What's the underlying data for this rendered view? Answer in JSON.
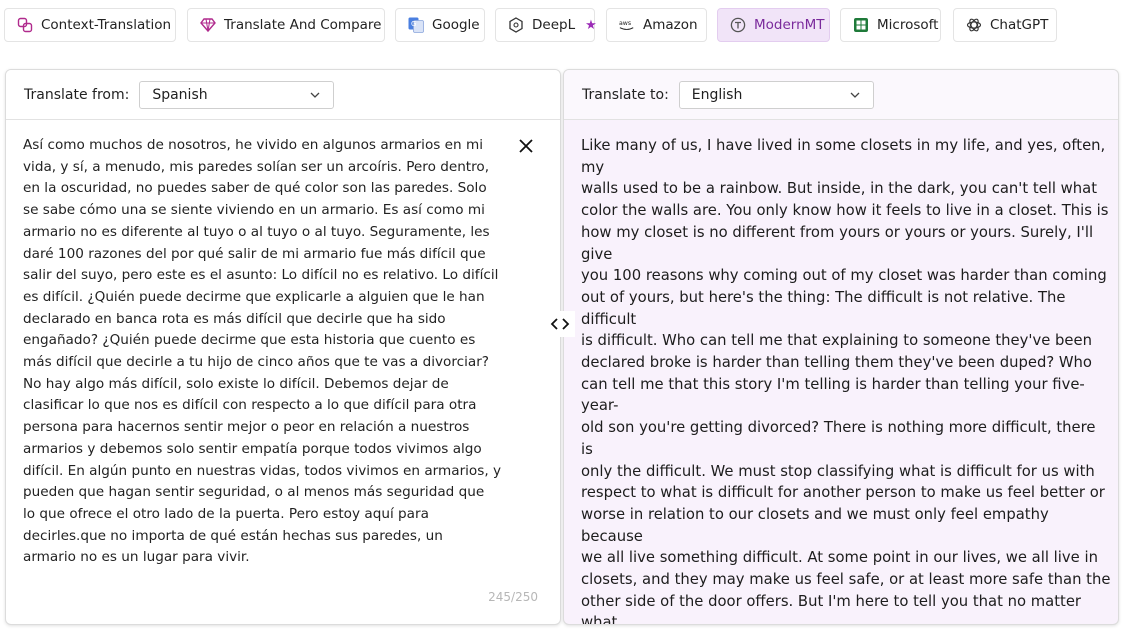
{
  "tabs": [
    {
      "label": "Context-Translation",
      "icon": "context-translation-icon"
    },
    {
      "label": "Translate And Compare",
      "icon": "diamond-icon"
    },
    {
      "label": "Google",
      "icon": "google-translate-icon"
    },
    {
      "label": "DeepL",
      "icon": "deepl-icon",
      "badge": "star-icon"
    },
    {
      "label": "Amazon",
      "icon": "aws-icon"
    },
    {
      "label": "ModernMT",
      "icon": "modernmt-icon",
      "active": true
    },
    {
      "label": "Microsoft",
      "icon": "microsoft-icon"
    },
    {
      "label": "ChatGPT",
      "icon": "chatgpt-icon"
    }
  ],
  "source": {
    "label": "Translate from:",
    "language": "Spanish",
    "text": "Así como muchos de nosotros, he vivido en algunos armarios en mi\nvida, y sí, a menudo, mis paredes solían ser un arcoíris. Pero dentro,\nen la oscuridad, no puedes saber de qué color son las paredes. Solo\nse sabe cómo una se siente viviendo en un armario. Es así como mi\narmario no es diferente al tuyo o al tuyo o al tuyo. Seguramente, les\ndaré 100 razones del por qué salir de mi armario fue más difícil que\nsalir del suyo, pero este es el asunto: Lo difícil no es relativo. Lo difícil\nes difícil. ¿Quién puede decirme que explicarle a alguien que le han\ndeclarado en banca rota es más difícil que decirle que ha sido\nengañado? ¿Quién puede decirme que esta historia que cuento es\nmás difícil que decirle a tu hijo de cinco años que te vas a divorciar?\nNo hay algo más difícil, solo existe lo difícil. Debemos dejar de\nclasificar lo que nos es difícil con respecto a lo que difícil para otra\npersona para hacernos sentir mejor o peor en relación a nuestros\narmarios y debemos solo sentir empatía porque todos vivimos algo\ndifícil. En algún punto en nuestras vidas, todos vivimos en armarios, y\npueden que hagan sentir seguridad, o al menos más seguridad que\nlo que ofrece el otro lado de la puerta. Pero estoy aquí para\ndecirles.que no importa de qué están hechas sus paredes, un\narmario no es un lugar para vivir.",
    "counter": "245/250"
  },
  "target": {
    "label": "Translate to:",
    "language": "English",
    "text": "Like many of us, I have lived in some closets in my life, and yes, often, my\nwalls used to be a rainbow. But inside, in the dark, you can't tell what\ncolor the walls are. You only know how it feels to live in a closet. This is\nhow my closet is no different from yours or yours or yours. Surely, I'll give\nyou 100 reasons why coming out of my closet was harder than coming\nout of yours, but here's the thing: The difficult is not relative. The difficult\nis difficult. Who can tell me that explaining to someone they've been\ndeclared broke is harder than telling them they've been duped? Who\ncan tell me that this story I'm telling is harder than telling your five-year-\nold son you're getting divorced? There is nothing more difficult, there is\nonly the difficult. We must stop classifying what is difficult for us with\nrespect to what is difficult for another person to make us feel better or\nworse in relation to our closets and we must only feel empathy because\nwe all live something difficult. At some point in our lives, we all live in\nclosets, and they may make us feel safe, or at least more safe than the\nother side of the door offers. But I'm here to tell you that no matter what\nyour walls are made of, a closet is not a place to live."
  },
  "colors": {
    "accent": "#7a2a9c",
    "active_tab_bg": "#f1e4f8",
    "target_panel_bg": "#f9f2fc"
  }
}
